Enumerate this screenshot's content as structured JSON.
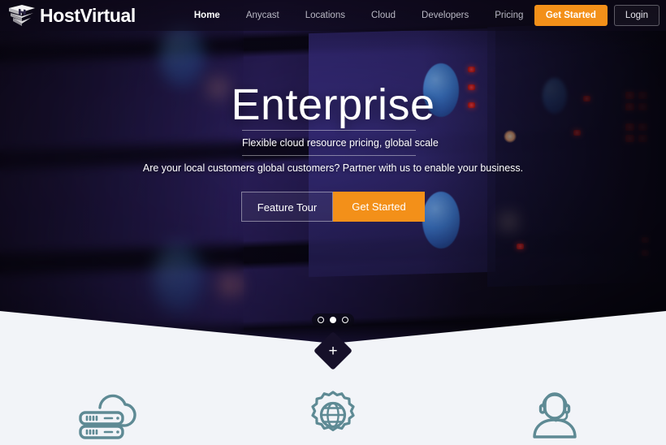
{
  "brand": {
    "name": "HostVirtual",
    "logo_icon": "layered-h-logo-icon"
  },
  "header": {
    "nav": [
      {
        "label": "Home",
        "name": "home",
        "active": true
      },
      {
        "label": "Anycast",
        "name": "anycast",
        "active": false
      },
      {
        "label": "Locations",
        "name": "locations",
        "active": false
      },
      {
        "label": "Cloud",
        "name": "cloud",
        "active": false
      },
      {
        "label": "Developers",
        "name": "developers",
        "active": false
      },
      {
        "label": "Pricing",
        "name": "pricing",
        "active": false
      }
    ],
    "get_started_label": "Get Started",
    "login_label": "Login",
    "accent_color": "#F39019",
    "background_color": "rgba(14,10,26,0.62)"
  },
  "hero": {
    "title": "Enterprise",
    "subtitle": "Flexible cloud resource pricing, global scale",
    "tagline": "Are your local customers global customers? Partner with us to enable your business.",
    "buttons": {
      "feature_tour_label": "Feature Tour",
      "get_started_label": "Get Started"
    },
    "carousel": {
      "total": 3,
      "active_index": 1
    },
    "scroll_badge_icon": "plus-icon"
  },
  "features": [
    {
      "icon": "cloud-server-icon",
      "name": "cloud-hosting"
    },
    {
      "icon": "globe-gear-icon",
      "name": "global-network"
    },
    {
      "icon": "support-agent-icon",
      "name": "support"
    }
  ],
  "colors": {
    "accent_orange": "#F39019",
    "section_background": "#F2F4F8",
    "icon_teal": "#5E8A94"
  }
}
